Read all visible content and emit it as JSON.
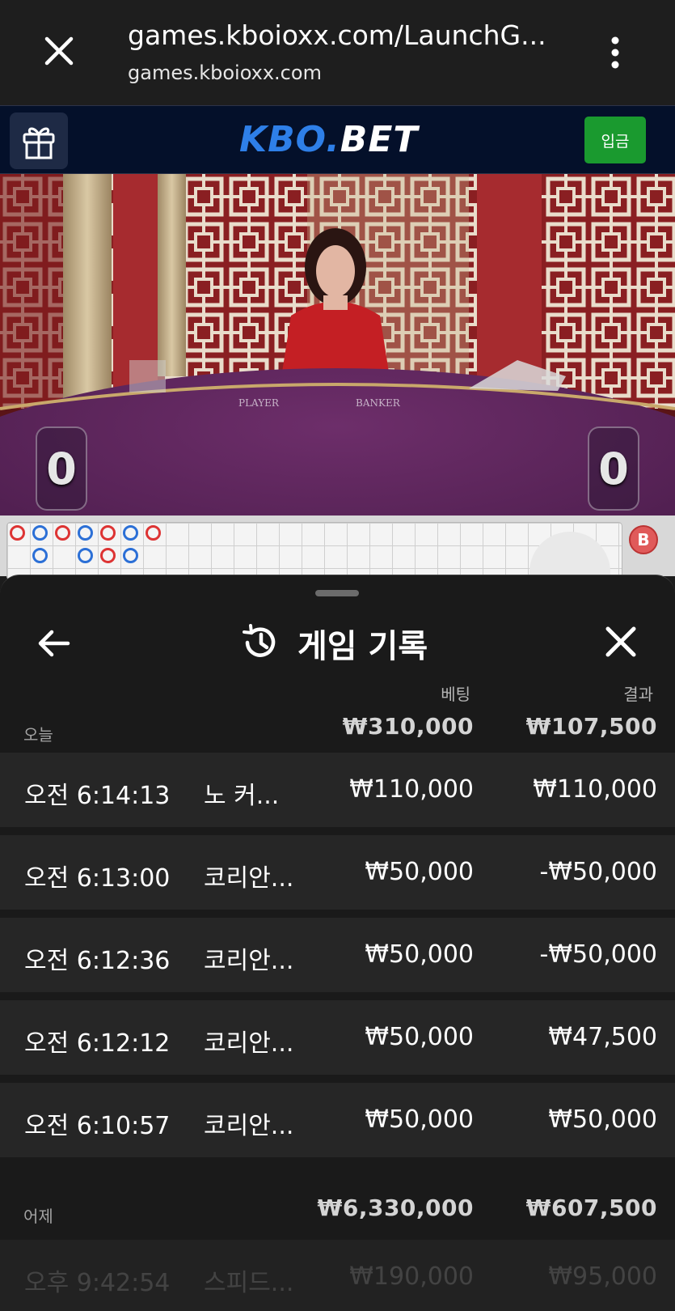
{
  "browser": {
    "url_title": "games.kboioxx.com/LaunchG...",
    "url_domain": "games.kboioxx.com"
  },
  "brand": {
    "logo_kbo": "KBO",
    "logo_dot": ".",
    "logo_bet": "BET",
    "deposit_label": "입금"
  },
  "table": {
    "player_score": "0",
    "banker_score": "0",
    "felt_player": "PLAYER",
    "felt_banker": "BANKER"
  },
  "history": {
    "title": "게임 기록",
    "col_bet": "베팅",
    "col_result": "결과",
    "today": {
      "label": "오늘",
      "bet_total": "₩310,000",
      "result_total": "₩107,500",
      "rows": [
        {
          "time": "오전 6:14:13",
          "game": "노 커...",
          "bet": "₩110,000",
          "result": "₩110,000"
        },
        {
          "time": "오전 6:13:00",
          "game": "코리안...",
          "bet": "₩50,000",
          "result": "-₩50,000"
        },
        {
          "time": "오전 6:12:36",
          "game": "코리안...",
          "bet": "₩50,000",
          "result": "-₩50,000"
        },
        {
          "time": "오전 6:12:12",
          "game": "코리안...",
          "bet": "₩50,000",
          "result": "₩47,500"
        },
        {
          "time": "오전 6:10:57",
          "game": "코리안...",
          "bet": "₩50,000",
          "result": "₩50,000"
        }
      ]
    },
    "yesterday": {
      "label": "어제",
      "bet_total": "₩6,330,000",
      "result_total": "₩607,500",
      "partial_row": {
        "time": "오후 9:42:54",
        "game": "스피드...",
        "bet": "₩190,000",
        "result": "₩95,000"
      }
    }
  },
  "colors": {
    "brand_blue": "#2e7fe8",
    "deposit_green": "#1a9a2f",
    "sheet_bg": "#1a1a1a",
    "row_bg": "#262626"
  }
}
